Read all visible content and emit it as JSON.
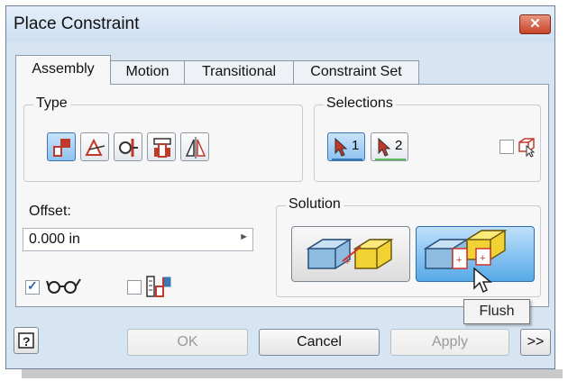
{
  "window": {
    "title": "Place Constraint",
    "close_label": "✕"
  },
  "tabs": [
    "Assembly",
    "Motion",
    "Transitional",
    "Constraint Set"
  ],
  "type_group": {
    "label": "Type",
    "buttons": [
      "mate-constraint-icon",
      "angle-constraint-icon",
      "tangent-constraint-icon",
      "insert-constraint-icon",
      "symmetry-constraint-icon"
    ],
    "selected": "mate-constraint-icon"
  },
  "selections_group": {
    "label": "Selections",
    "select1": "1",
    "select2": "2",
    "pick_part_first_checked": false
  },
  "offset": {
    "label": "Offset:",
    "value": "0.000 in"
  },
  "solution_group": {
    "label": "Solution",
    "options": [
      "mate",
      "flush"
    ],
    "selected": "flush"
  },
  "options": {
    "show_preview_checked": true,
    "predict_offset_checked": false
  },
  "tooltip": "Flush",
  "footer": {
    "ok": "OK",
    "cancel": "Cancel",
    "apply": "Apply",
    "more": ">>"
  }
}
